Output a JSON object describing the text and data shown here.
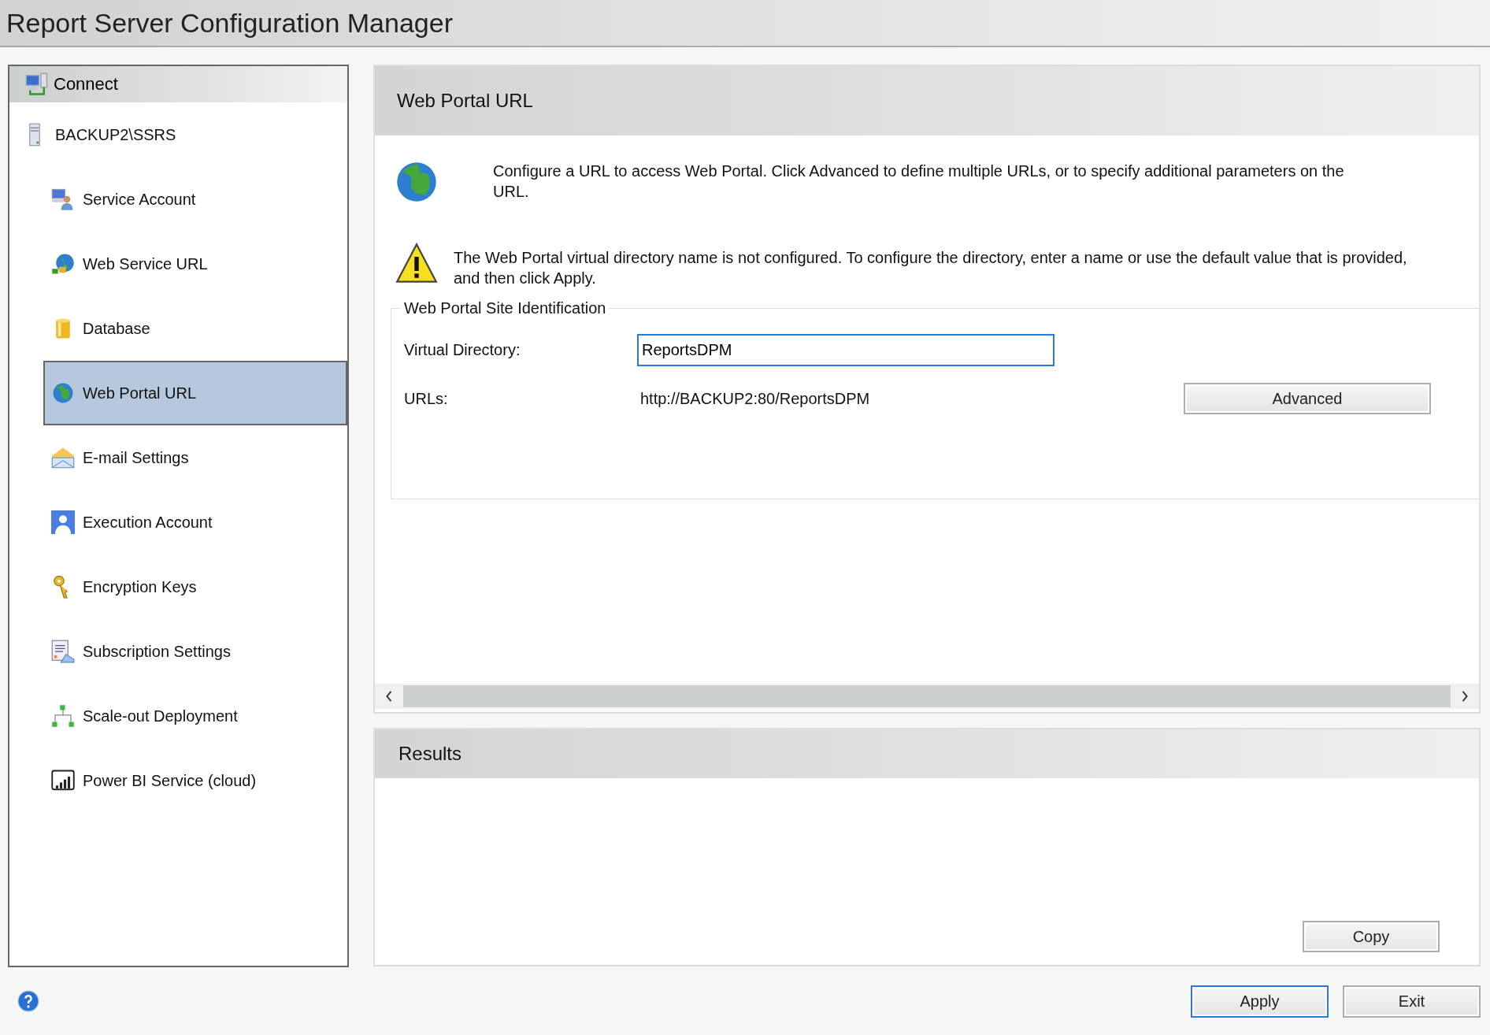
{
  "window": {
    "title": "Report Server Configuration Manager"
  },
  "sidebar": {
    "connect": "Connect",
    "server": "BACKUP2\\SSRS",
    "items": [
      {
        "label": "Service Account",
        "kind": "account",
        "selected": false
      },
      {
        "label": "Web Service URL",
        "kind": "webservice",
        "selected": false
      },
      {
        "label": "Database",
        "kind": "database",
        "selected": false
      },
      {
        "label": "Web Portal URL",
        "kind": "globe",
        "selected": true
      },
      {
        "label": "E-mail Settings",
        "kind": "mail",
        "selected": false
      },
      {
        "label": "Execution Account",
        "kind": "person",
        "selected": false
      },
      {
        "label": "Encryption Keys",
        "kind": "key",
        "selected": false
      },
      {
        "label": "Subscription Settings",
        "kind": "document",
        "selected": false
      },
      {
        "label": "Scale-out Deployment",
        "kind": "network",
        "selected": false
      },
      {
        "label": "Power BI Service (cloud)",
        "kind": "chart",
        "selected": false
      }
    ]
  },
  "page": {
    "title": "Web Portal URL",
    "intro": "Configure a URL to access Web Portal.  Click Advanced to define multiple URLs, or to specify additional parameters on the URL.",
    "warning": "The Web Portal virtual directory name is not configured. To configure the directory, enter a name or use the default value that is provided, and then click Apply.",
    "group": {
      "title": "Web Portal Site Identification",
      "fields": [
        {
          "label": "Virtual Directory:",
          "value": "ReportsDPM",
          "kind": "input"
        },
        {
          "label": "URLs:",
          "value": "http://BACKUP2:80/ReportsDPM",
          "kind": "text"
        }
      ],
      "advanced": "Advanced"
    }
  },
  "results": {
    "title": "Results",
    "copy": "Copy"
  },
  "buttons": [
    "Apply",
    "Exit"
  ]
}
